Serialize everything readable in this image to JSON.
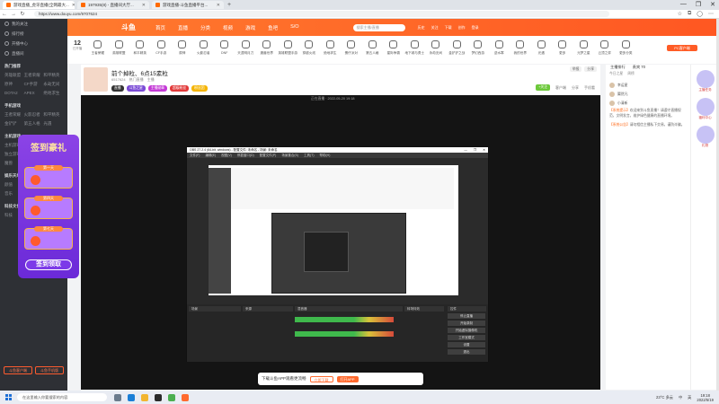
{
  "browser": {
    "tabs": [
      {
        "label": "游戏直播_虎牙直播(全网最大..."
      },
      {
        "label": "197935(8) - 直播间大厅..."
      },
      {
        "label": "游戏直播-斗鱼直播平台..."
      }
    ],
    "new_tab": "+",
    "window_controls": [
      "—",
      "❐",
      "✕"
    ],
    "url": "https://www.douyu.com/9707624",
    "addr_icons": [
      "←",
      "→",
      "↻"
    ]
  },
  "topnav": {
    "logo": "斗鱼",
    "links": [
      "首页",
      "直播",
      "分类",
      "视频",
      "游戏",
      "鱼吧",
      "S/O"
    ],
    "search_placeholder": "搜索主播/直播",
    "icons": [
      "历史",
      "关注",
      "下载",
      "创作",
      "登录"
    ]
  },
  "catbar": {
    "count": "12",
    "count_label": "已开播",
    "items": [
      "王者荣耀",
      "英雄联盟",
      "和平精英",
      "CF手游",
      "原神",
      "火影忍者",
      "DNF",
      "天涯明月刀",
      "魔兽世界",
      "英雄联盟手游",
      "穿越火线",
      "绝地求生",
      "蛋仔派对",
      "第五人格",
      "星际争霸",
      "地下城与勇士",
      "永劫无间",
      "金铲铲之战",
      "梦幻西游",
      "逆水寒",
      "我的世界",
      "光遇",
      "更多",
      "元梦之星",
      "云顶之弈",
      "更多分类"
    ],
    "pc_button": "PC客户端"
  },
  "room": {
    "title": "前个掉粒、6点15素粒",
    "meta": [
      "6517624",
      "热门直播",
      "主播"
    ],
    "badges": [
      {
        "text": "直播",
        "color": "#333333"
      },
      {
        "text": "斗鱼之星",
        "color": "#7b4cd6"
      },
      {
        "text": "主播勋章",
        "color": "#c43ad6"
      },
      {
        "text": "超级粉丝",
        "color": "#e23a3a"
      },
      {
        "text": "粉丝团",
        "color": "#f5b400"
      }
    ],
    "buttons": [
      "举报",
      "分享"
    ],
    "follow": "+关注",
    "icons": [
      "客户端",
      "分享",
      "手机看"
    ]
  },
  "player": {
    "info": "正在直播 · 2022-05-20 19:18",
    "obs_title": "OBS 27.2.4 (64-bit, windows) - 配置文件: 未命名 - 场景: 未命名",
    "obs_menu": [
      "文件(F)",
      "编辑(E)",
      "视图(V)",
      "停靠窗口(D)",
      "配置文件(P)",
      "场景集合(S)",
      "工具(T)",
      "帮助(H)"
    ],
    "dock_headers": [
      "场景",
      "来源",
      "混音器",
      "转场特效",
      "控件"
    ],
    "obs_buttons": [
      "停止直播",
      "开始录制",
      "开始虚拟摄像机",
      "工作室模式",
      "设置",
      "退出"
    ]
  },
  "promo": {
    "title": "签到豪礼",
    "days": [
      "第一天",
      "第四天",
      "第七天"
    ],
    "button": "签到领取",
    "close": "×"
  },
  "toast": {
    "text": "下载斗鱼APP观看更流畅",
    "btn1": "立即下载",
    "btn2": "打开APP"
  },
  "chat": {
    "tabs": [
      "主播排行",
      "贵宾 70"
    ],
    "subtabs": [
      "今日之星",
      "周榜"
    ],
    "rank": [
      "幸运星",
      "翼然凡",
      "小清新"
    ],
    "msgs": [
      {
        "sys": "【系统提示】",
        "text": "欢迎来到斗鱼直播！请遵守直播规范，文明发言，维护绿色健康的直播环境。"
      },
      {
        "sys": "【系统公告】",
        "text": "请勿相信主播私下交易，谨防诈骗。"
      }
    ]
  },
  "rightbar": {
    "items": [
      "主播任务",
      "福利中心",
      "礼物"
    ]
  },
  "sidebar": {
    "items": [
      "我的关注",
      "排行榜",
      "开播中心",
      "直播间"
    ],
    "sections": [
      {
        "title": "热门推荐",
        "items": [
          "英雄联盟",
          "王者荣耀",
          "和平精英",
          "原神",
          "CF手游",
          "永劫无间",
          "DOTA2",
          "APEX",
          "绝地求生"
        ]
      },
      {
        "title": "手机游戏",
        "items": [
          "王者荣耀",
          "火影忍者",
          "和平精英",
          "金铲铲",
          "第五人格",
          "光遇"
        ]
      },
      {
        "title": "主机游戏",
        "items": [
          "主机游戏",
          "单机热门",
          "怀旧经典",
          "独立游戏",
          "恐怖游戏",
          "CF",
          "魔兽",
          "方舟",
          "我的世界"
        ]
      },
      {
        "title": "娱乐天地",
        "items": [
          "颜值",
          "二次元",
          "户外",
          "音乐",
          "舞蹈",
          "聊天"
        ]
      },
      {
        "title": "科技文化",
        "items": [
          "科技",
          "数码",
          "汽车"
        ]
      }
    ],
    "bottom_buttons": [
      "斗鱼客户端",
      "斗鱼手机版"
    ]
  },
  "taskbar": {
    "search": "在这里输入你要搜索的内容",
    "tray": [
      "23°C 多云",
      "中",
      "英"
    ],
    "time": "19:18",
    "date": "2022/5/19"
  },
  "colors": {
    "accent": "#ff5722",
    "sidebar": "#2e3035",
    "player_bg": "#141414"
  }
}
